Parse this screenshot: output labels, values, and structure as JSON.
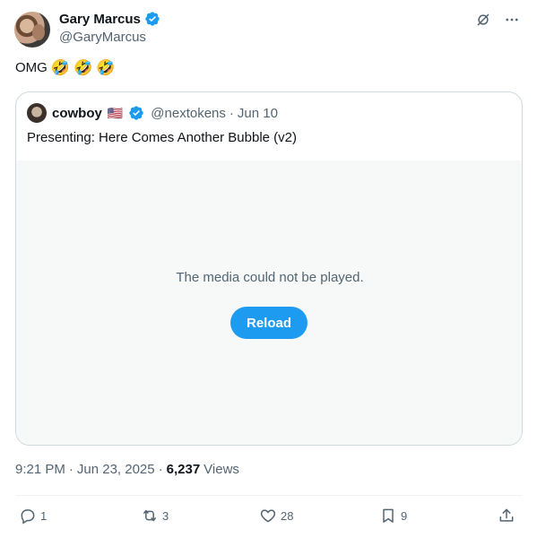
{
  "author": {
    "name": "Gary Marcus",
    "handle": "@GaryMarcus",
    "verified": true
  },
  "tweet_text": "OMG",
  "tweet_emojis": [
    "🤣",
    "🤣",
    "🤣"
  ],
  "quoted": {
    "name": "cowboy",
    "flag": "🇺🇸",
    "verified": true,
    "handle": "@nextokens",
    "separator": "·",
    "date": "Jun 10",
    "text": "Presenting: Here Comes Another Bubble (v2)",
    "media_error": "The media could not be played.",
    "reload_label": "Reload"
  },
  "meta": {
    "time": "9:21 PM",
    "sep1": "·",
    "date": "Jun 23, 2025",
    "sep2": "·",
    "views_count": "6,237",
    "views_label": "Views"
  },
  "actions": {
    "replies": "1",
    "reposts": "3",
    "likes": "28",
    "bookmarks": "9"
  },
  "colors": {
    "accent": "#1d9bf0",
    "secondary_text": "#536471",
    "primary_text": "#0f1419"
  }
}
